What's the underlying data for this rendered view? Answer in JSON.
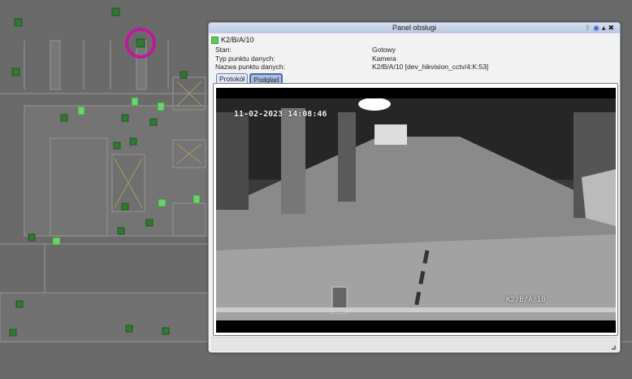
{
  "panel": {
    "title": "Panel obsługi",
    "icons": [
      "pin-icon",
      "help-icon",
      "minimize-icon",
      "close-icon"
    ],
    "point_name": "K2/B/A/10",
    "fields": [
      {
        "label": "Stan:",
        "value": "Gotowy"
      },
      {
        "label": "Typ punktu danych:",
        "value": "Kamera"
      },
      {
        "label": "Nazwa punktu danych:",
        "value": "K2/B/A/10 [dev_hikvision_cctv/4:K:53]"
      }
    ],
    "tabs": [
      {
        "label": "Protokół",
        "active": false
      },
      {
        "label": "Podgląd",
        "active": true
      }
    ],
    "video": {
      "timestamp": "11-02-2023 14:08:46",
      "camera_label": "K2/B/A/10"
    }
  },
  "colors": {
    "highlight_ring": "#c0189a",
    "device_green": "#3aa83a",
    "map_bg": "#6a6a6a"
  }
}
